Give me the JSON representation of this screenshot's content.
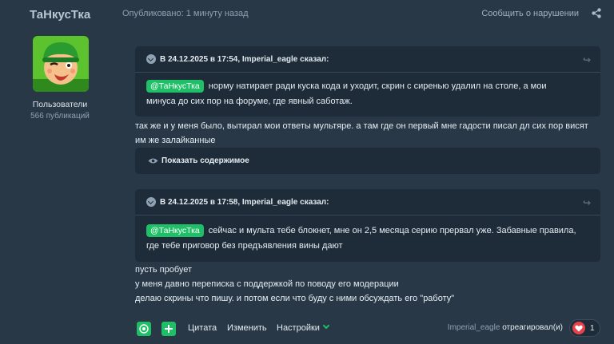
{
  "post": {
    "author": "ТаНкусТка",
    "published": "Опубликовано: 1 минуту назад",
    "report": "Сообщить о нарушении",
    "user_group": "Пользователи",
    "post_count": "566 публикаций"
  },
  "quote1": {
    "header": "В 24.12.2025 в 17:54, Imperial_eagle сказал:",
    "mention": "@ТаНкусТка",
    "line1": "норму натирает ради куска кода и уходит, скрин с сиренью удалил на столе, а мои",
    "line2": "минуса до сих пор на форуме, где явный саботаж."
  },
  "reply1": {
    "line1": "так же и у меня было, вытирал мои ответы мультяре. а там где он первый мне гадости писал дл сих пор висят",
    "line2": "им же залайканные"
  },
  "spoiler": {
    "label": "Показать содержимое"
  },
  "quote2": {
    "header": "В 24.12.2025 в 17:58, Imperial_eagle сказал:",
    "mention": "@ТаНкусТка",
    "line1": "сейчас и мульта тебе блокнет, мне он 2,5 месяца серию прервал уже. Забавные правила,",
    "line2": "где тебе приговор без предъявления вины дают"
  },
  "reply2": {
    "line1": "пусть пробует",
    "line2": "у меня давно переписка с поддержкой по поводу его модерации",
    "line3": "делаю скрины что пишу. и потом если что буду с ними обсуждать его \"работу\""
  },
  "footer": {
    "quote": "Цитата",
    "edit": "Изменить",
    "settings": "Настройки",
    "reacted_user": "Imperial_eagle",
    "reacted_text": "отреагировал(и)",
    "like_count": "1"
  },
  "colors": {
    "background": "#283846",
    "panel": "#1e2c39",
    "accent": "#1fbf67",
    "heart": "#e8414b"
  },
  "icons": [
    "share-icon",
    "chevron-icon",
    "reply-arrow-icon",
    "eye-icon",
    "emoji-icon",
    "plus-icon",
    "heart-icon"
  ]
}
